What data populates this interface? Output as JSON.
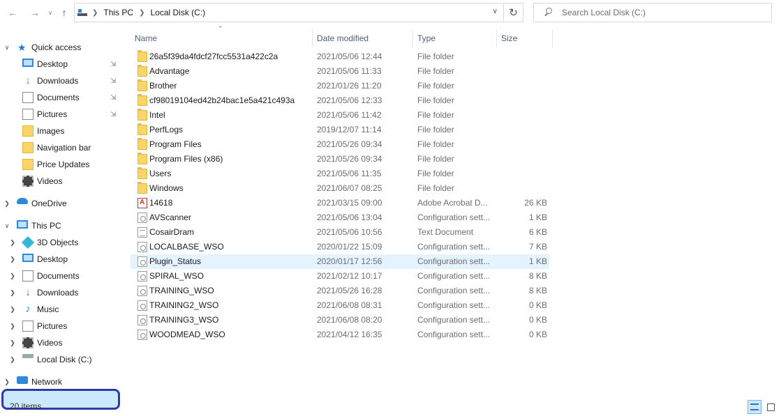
{
  "address": {
    "crumbs": [
      "This PC",
      "Local Disk (C:)"
    ]
  },
  "search": {
    "placeholder": "Search Local Disk (C:)"
  },
  "sidebar": {
    "quick_access": {
      "label": "Quick access",
      "items": [
        {
          "label": "Desktop",
          "icon": "desktop-icon",
          "pinned": true
        },
        {
          "label": "Downloads",
          "icon": "downloads-icon",
          "pinned": true
        },
        {
          "label": "Documents",
          "icon": "documents-icon",
          "pinned": true
        },
        {
          "label": "Pictures",
          "icon": "pictures-icon",
          "pinned": true
        },
        {
          "label": "Images",
          "icon": "folder-icon",
          "pinned": false
        },
        {
          "label": "Navigation bar",
          "icon": "folder-icon",
          "pinned": false
        },
        {
          "label": "Price Updates",
          "icon": "folder-icon",
          "pinned": false
        },
        {
          "label": "Videos",
          "icon": "videos-icon",
          "pinned": false
        }
      ]
    },
    "onedrive": "OneDrive",
    "this_pc": {
      "label": "This PC",
      "items": [
        {
          "label": "3D Objects",
          "icon": "3d-objects-icon"
        },
        {
          "label": "Desktop",
          "icon": "desktop-icon"
        },
        {
          "label": "Documents",
          "icon": "documents-icon"
        },
        {
          "label": "Downloads",
          "icon": "downloads-icon"
        },
        {
          "label": "Music",
          "icon": "music-icon"
        },
        {
          "label": "Pictures",
          "icon": "pictures-icon"
        },
        {
          "label": "Videos",
          "icon": "videos-icon"
        },
        {
          "label": "Local Disk (C:)",
          "icon": "drive-icon"
        }
      ]
    },
    "network": "Network"
  },
  "columns": {
    "name": "Name",
    "date": "Date modified",
    "type": "Type",
    "size": "Size"
  },
  "files": [
    {
      "name": "26a5f39da4fdcf27fcc5531a422c2a",
      "date": "2021/05/06 12:44",
      "type": "File folder",
      "size": "",
      "kind": "folder"
    },
    {
      "name": "Advantage",
      "date": "2021/05/06 11:33",
      "type": "File folder",
      "size": "",
      "kind": "folder"
    },
    {
      "name": "Brother",
      "date": "2021/01/26 11:20",
      "type": "File folder",
      "size": "",
      "kind": "folder"
    },
    {
      "name": "cf98019104ed42b24bac1e5a421c493a",
      "date": "2021/05/06 12:33",
      "type": "File folder",
      "size": "",
      "kind": "folder"
    },
    {
      "name": "Intel",
      "date": "2021/05/06 11:42",
      "type": "File folder",
      "size": "",
      "kind": "folder"
    },
    {
      "name": "PerfLogs",
      "date": "2019/12/07 11:14",
      "type": "File folder",
      "size": "",
      "kind": "folder"
    },
    {
      "name": "Program Files",
      "date": "2021/05/26 09:34",
      "type": "File folder",
      "size": "",
      "kind": "folder"
    },
    {
      "name": "Program Files (x86)",
      "date": "2021/05/26 09:34",
      "type": "File folder",
      "size": "",
      "kind": "folder"
    },
    {
      "name": "Users",
      "date": "2021/05/06 11:35",
      "type": "File folder",
      "size": "",
      "kind": "folder"
    },
    {
      "name": "Windows",
      "date": "2021/06/07 08:25",
      "type": "File folder",
      "size": "",
      "kind": "folder"
    },
    {
      "name": "14618",
      "date": "2021/03/15 09:00",
      "type": "Adobe Acrobat D...",
      "size": "26 KB",
      "kind": "pdf"
    },
    {
      "name": "AVScanner",
      "date": "2021/05/06 13:04",
      "type": "Configuration sett...",
      "size": "1 KB",
      "kind": "config"
    },
    {
      "name": "CosairDram",
      "date": "2021/05/06 10:56",
      "type": "Text Document",
      "size": "6 KB",
      "kind": "text"
    },
    {
      "name": "LOCALBASE_WSO",
      "date": "2020/01/22 15:09",
      "type": "Configuration sett...",
      "size": "7 KB",
      "kind": "config"
    },
    {
      "name": "Plugin_Status",
      "date": "2020/01/17 12:56",
      "type": "Configuration sett...",
      "size": "1 KB",
      "kind": "config",
      "highlighted": true
    },
    {
      "name": "SPIRAL_WSO",
      "date": "2021/02/12 10:17",
      "type": "Configuration sett...",
      "size": "8 KB",
      "kind": "config"
    },
    {
      "name": "TRAINING_WSO",
      "date": "2021/05/26 16:28",
      "type": "Configuration sett...",
      "size": "8 KB",
      "kind": "config"
    },
    {
      "name": "TRAINING2_WSO",
      "date": "2021/06/08 08:31",
      "type": "Configuration sett...",
      "size": "0 KB",
      "kind": "config"
    },
    {
      "name": "TRAINING3_WSO",
      "date": "2021/06/08 08:20",
      "type": "Configuration sett...",
      "size": "0 KB",
      "kind": "config"
    },
    {
      "name": "WOODMEAD_WSO",
      "date": "2021/04/12 16:35",
      "type": "Configuration sett...",
      "size": "0 KB",
      "kind": "config"
    }
  ],
  "status": {
    "count": "20 items"
  },
  "colors": {
    "selection": "#cce8ff",
    "highlight_ring": "#2e3aa8",
    "row_hover": "#e5f3ff"
  }
}
